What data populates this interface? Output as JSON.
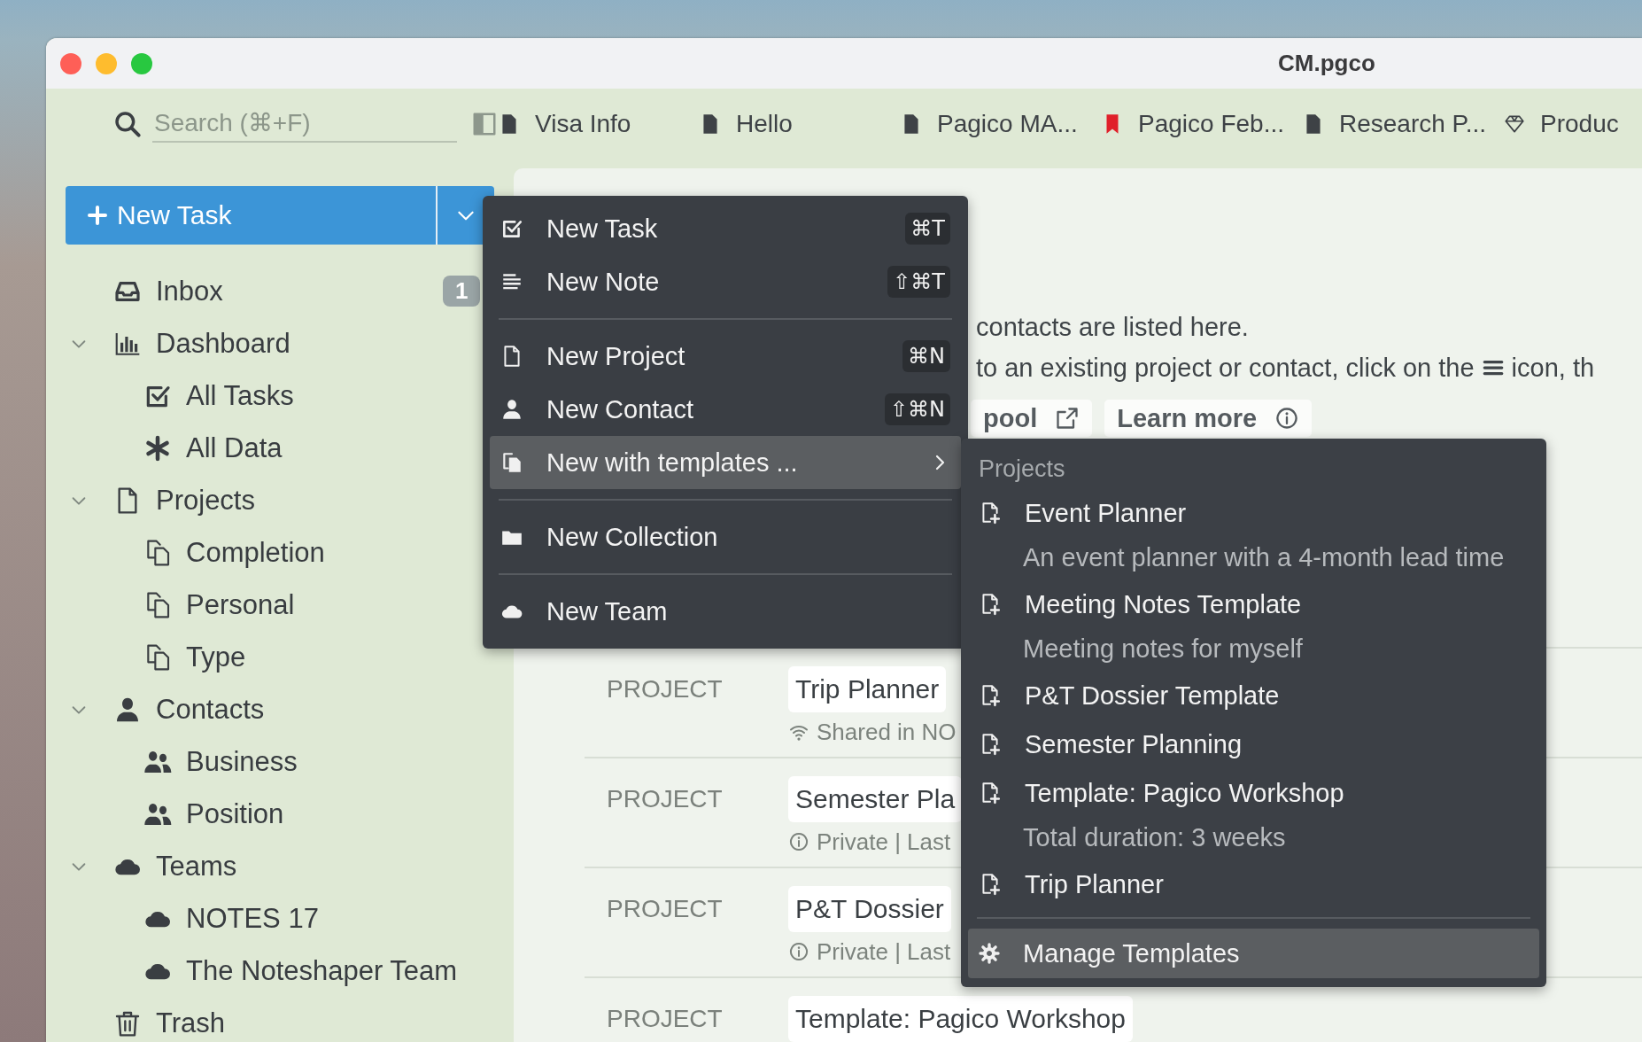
{
  "window": {
    "title": "CM.pgco"
  },
  "search": {
    "placeholder": "Search (⌘+F)"
  },
  "tabs": [
    {
      "label": "Visa Info",
      "kind": "document"
    },
    {
      "label": "Hello",
      "kind": "document"
    },
    {
      "label": "Pagico MA...",
      "kind": "document"
    },
    {
      "label": "Pagico Feb...",
      "kind": "bookmark"
    },
    {
      "label": "Research P...",
      "kind": "document"
    },
    {
      "label": "Produc",
      "kind": "diamond"
    }
  ],
  "new_task_button": {
    "label": "New Task"
  },
  "sidebar": {
    "items": [
      {
        "label": "Inbox",
        "kind": "inbox",
        "badge": "1"
      },
      {
        "label": "Dashboard",
        "kind": "dashboard",
        "expanded": true,
        "children": [
          {
            "label": "All Tasks",
            "kind": "tasks"
          },
          {
            "label": "All Data",
            "kind": "data"
          }
        ]
      },
      {
        "label": "Projects",
        "kind": "projects",
        "expanded": true,
        "children": [
          {
            "label": "Completion",
            "kind": "folder"
          },
          {
            "label": "Personal",
            "kind": "folder"
          },
          {
            "label": "Type",
            "kind": "folder"
          }
        ]
      },
      {
        "label": "Contacts",
        "kind": "contacts",
        "expanded": true,
        "children": [
          {
            "label": "Business",
            "kind": "group"
          },
          {
            "label": "Position",
            "kind": "group"
          }
        ]
      },
      {
        "label": "Teams",
        "kind": "teams",
        "expanded": true,
        "children": [
          {
            "label": "NOTES 17",
            "kind": "team"
          },
          {
            "label": "The Noteshaper Team",
            "kind": "team"
          }
        ]
      },
      {
        "label": "Trash",
        "kind": "trash"
      }
    ]
  },
  "content": {
    "intro": "contacts are listed here.",
    "hint_before_icon": "to an existing project or contact, click on the",
    "hint_after_icon": "icon, th",
    "buttons": [
      {
        "label": "pool",
        "kind": "external"
      },
      {
        "label": "Learn more",
        "kind": "info"
      }
    ],
    "rows": [
      {
        "type_label": "PROJECT",
        "title": "Trip Planner",
        "kind": "shared",
        "meta": "Shared in NO"
      },
      {
        "type_label": "PROJECT",
        "title": "Semester Pla",
        "kind": "private",
        "meta": "Private | Last"
      },
      {
        "type_label": "PROJECT",
        "title": "P&T Dossier",
        "kind": "private",
        "meta": "Private | Last"
      },
      {
        "type_label": "PROJECT",
        "title": "Template: Pagico Workshop"
      }
    ]
  },
  "menu": {
    "items": [
      {
        "label": "New Task",
        "kind": "task",
        "shortcut": "⌘T",
        "selected": false
      },
      {
        "label": "New Note",
        "kind": "note",
        "shortcut": "⇧⌘T",
        "selected": false,
        "divider_after": true
      },
      {
        "label": "New Project",
        "kind": "project",
        "shortcut": "⌘N",
        "selected": false
      },
      {
        "label": "New Contact",
        "kind": "contact",
        "shortcut": "⇧⌘N",
        "selected": false
      },
      {
        "label": "New with templates ...",
        "kind": "templates",
        "submenu": true,
        "selected": true,
        "divider_after": true
      },
      {
        "label": "New Collection",
        "kind": "collection",
        "selected": false,
        "divider_after": true
      },
      {
        "label": "New Team",
        "kind": "team",
        "selected": false
      }
    ]
  },
  "submenu": {
    "heading": "Projects",
    "items": [
      {
        "label": "Event Planner",
        "description": "An event planner with a 4-month lead time",
        "selected": false
      },
      {
        "label": "Meeting Notes Template",
        "description": "Meeting notes for myself",
        "selected": false
      },
      {
        "label": "P&T Dossier Template",
        "selected": false
      },
      {
        "label": "Semester Planning",
        "selected": false
      },
      {
        "label": "Template: Pagico Workshop",
        "description": "Total duration: 3 weeks",
        "selected": false
      },
      {
        "label": "Trip Planner",
        "selected": false
      }
    ],
    "footer": {
      "label": "Manage Templates",
      "selected": true
    }
  }
}
